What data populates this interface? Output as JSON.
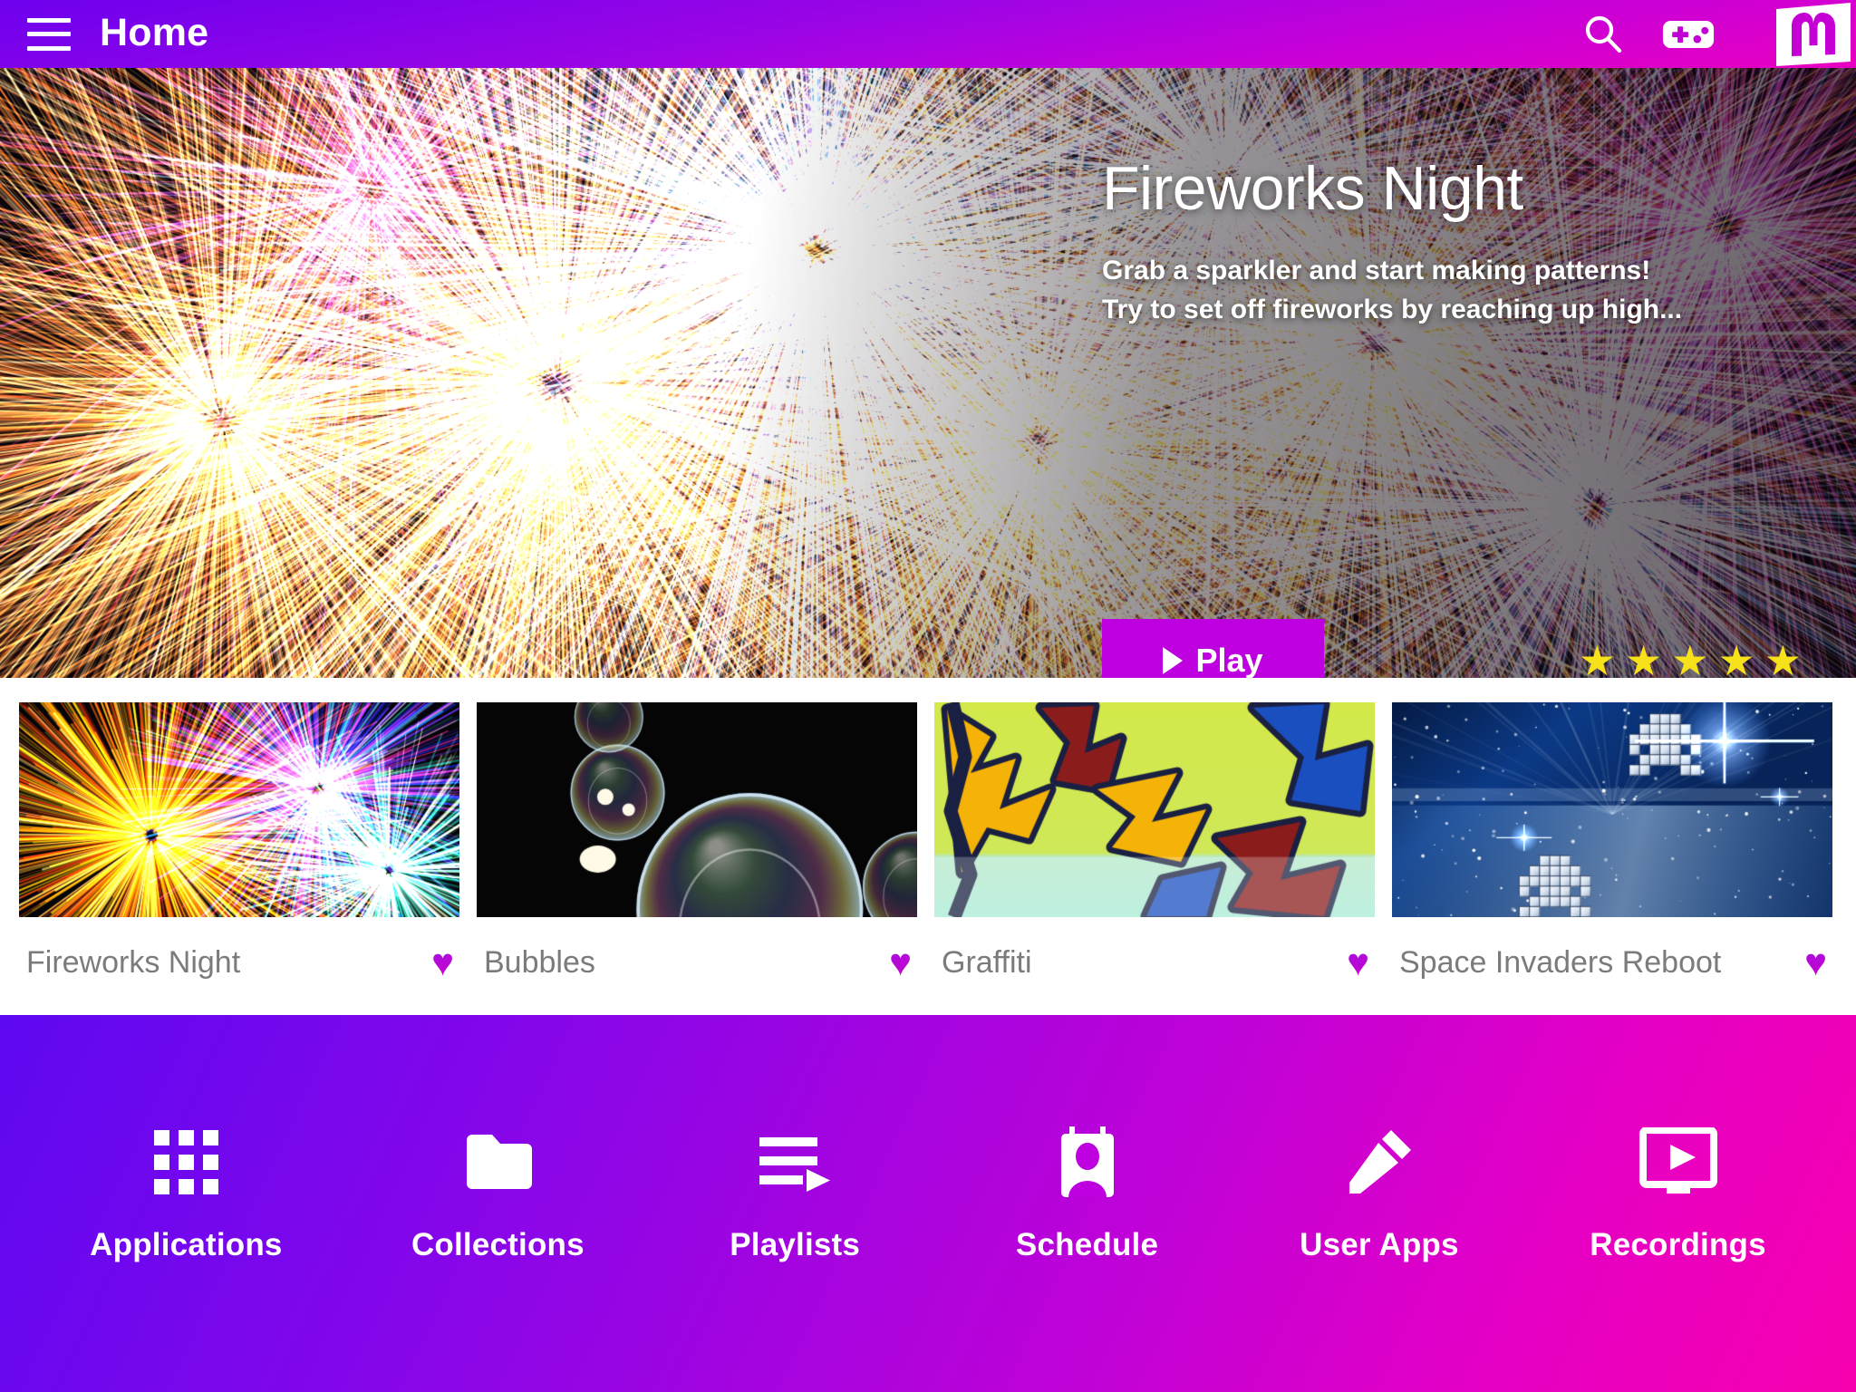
{
  "topbar": {
    "menu_icon": "hamburger-menu-icon",
    "title": "Home",
    "search_icon": "search-icon",
    "gamepad_icon": "gamepad-icon",
    "logo_text": "M",
    "logo_icon": "magic-m-logo"
  },
  "hero": {
    "title": "Fireworks Night",
    "description": "Grab a sparkler and start making patterns! Try to set off fireworks by reaching up high...",
    "description_line1": "Grab a sparkler and start making patterns!",
    "description_line2": "Try to set off fireworks by reaching up high...",
    "play_label": "Play",
    "play_icon": "play-triangle-icon",
    "rating": 5,
    "rating_max": 5,
    "star_glyph": "★",
    "star_color": "#F7E11A",
    "play_button_color": "#BE00E0",
    "pager_dot_color": "#1878E8"
  },
  "cards": [
    {
      "title": "Fireworks Night",
      "favorite": true,
      "heart_glyph": "♥",
      "thumb": "fireworks-sparks"
    },
    {
      "title": "Bubbles",
      "favorite": true,
      "heart_glyph": "♥",
      "thumb": "soap-bubbles"
    },
    {
      "title": "Graffiti",
      "favorite": true,
      "heart_glyph": "♥",
      "thumb": "graffiti-wall"
    },
    {
      "title": "Space Invaders Reboot",
      "favorite": true,
      "heart_glyph": "♥",
      "thumb": "space-invaders"
    }
  ],
  "bottom_nav": [
    {
      "label": "Applications",
      "icon": "grid-apps-icon"
    },
    {
      "label": "Collections",
      "icon": "folder-icon"
    },
    {
      "label": "Playlists",
      "icon": "playlist-lines-play-icon"
    },
    {
      "label": "Schedule",
      "icon": "contact-card-person-icon"
    },
    {
      "label": "User Apps",
      "icon": "pencil-icon"
    },
    {
      "label": "Recordings",
      "icon": "monitor-play-icon"
    }
  ],
  "theme": {
    "accent_purple": "#8A06E8",
    "accent_magenta": "#E600C4",
    "heart_color": "#BE00E0",
    "card_label_color": "#7b7b7b",
    "surface": "#ffffff"
  }
}
